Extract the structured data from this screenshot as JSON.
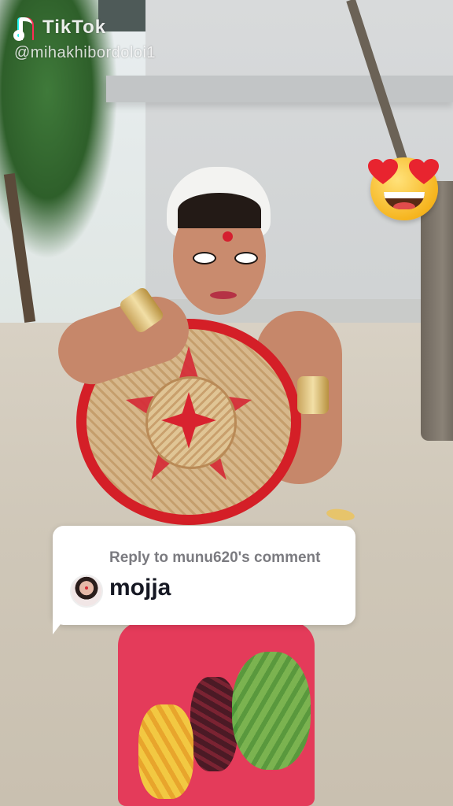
{
  "watermark": {
    "brand": "TikTok",
    "handle": "@mihakhibordoloi1"
  },
  "sticker": {
    "emoji_icon": "heart-eyes-emoji"
  },
  "reply_card": {
    "label": "Reply to munu620's comment",
    "comment": "mojja"
  },
  "colors": {
    "card_bg": "#ffffff",
    "label_gray": "#7b7b80",
    "comment_text": "#161823",
    "tiktok_cyan": "#25f4ee",
    "tiktok_red": "#fe2c55"
  }
}
